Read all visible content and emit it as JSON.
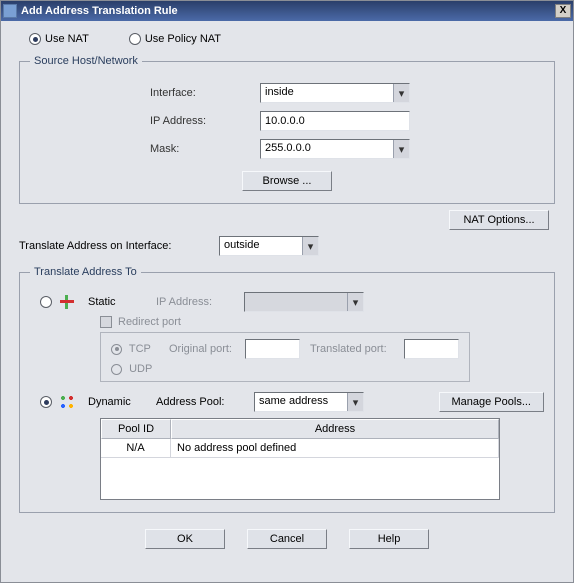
{
  "window": {
    "title": "Add Address Translation Rule",
    "close_x": "X"
  },
  "nat_mode": {
    "use_nat": "Use NAT",
    "use_policy_nat": "Use Policy NAT"
  },
  "source_group": {
    "legend": "Source Host/Network",
    "interface_label": "Interface:",
    "interface_value": "inside",
    "ip_label": "IP Address:",
    "ip_value": "10.0.0.0",
    "mask_label": "Mask:",
    "mask_value": "255.0.0.0",
    "browse_btn": "Browse ..."
  },
  "nat_options_btn": "NAT Options...",
  "translate_on": {
    "label": "Translate Address on Interface:",
    "value": "outside"
  },
  "translate_to": {
    "legend": "Translate Address To",
    "static_label": "Static",
    "static_ip_label": "IP Address:",
    "redirect_port_label": "Redirect port",
    "tcp_label": "TCP",
    "udp_label": "UDP",
    "original_port_label": "Original port:",
    "translated_port_label": "Translated port:",
    "dynamic_label": "Dynamic",
    "address_pool_label": "Address Pool:",
    "address_pool_value": "same address",
    "manage_pools_btn": "Manage Pools...",
    "pool_table": {
      "header_pool_id": "Pool ID",
      "header_address": "Address",
      "row_pool_id": "N/A",
      "row_address": "No address pool defined"
    }
  },
  "buttons": {
    "ok": "OK",
    "cancel": "Cancel",
    "help": "Help"
  }
}
